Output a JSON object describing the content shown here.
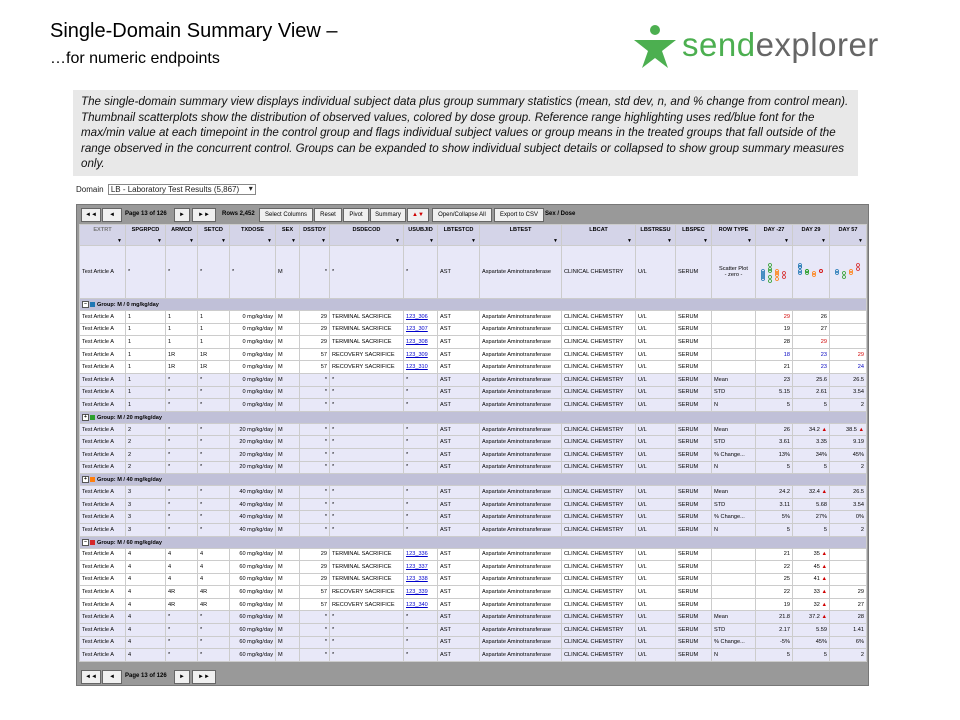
{
  "header": {
    "title": "Single-Domain Summary View –",
    "subtitle": "…for numeric endpoints",
    "logo_text_a": "send",
    "logo_text_b": "explorer"
  },
  "description": "The single-domain summary view displays individual subject data plus group summary statistics (mean, std dev, n, and % change from control mean). Thumbnail scatterplots show the distribution of observed values, colored by dose group. Reference range highlighting uses red/blue font for the max/min value at each timepoint in the control group and flags individual subject values or group means in the treated groups that fall outside of the range observed in the concurrent control. Groups can be expanded to show individual subject details or collapsed to show group summary measures only.",
  "domain": {
    "label": "Domain",
    "value": "LB - Laboratory Test Results (5,867)"
  },
  "toolbar": {
    "first": "◄◄",
    "prev": "◄",
    "page": "Page 13 of 126",
    "next": "►",
    "last": "►►",
    "rows": "Rows 2,452",
    "select_columns": "Select Columns",
    "reset": "Reset",
    "pivot": "Pivot",
    "summary": "Summary",
    "sort": "▲▼",
    "open_collapse": "Open/Collapse All",
    "export": "Export to CSV",
    "sex_dose": "Sex / Dose"
  },
  "columns": [
    "EXTRT",
    "SPGRPCD",
    "ARMCD",
    "SETCD",
    "TXDOSE",
    "SEX",
    "DSSTDY",
    "DSDECOD",
    "USUBJID",
    "LBTESTCD",
    "LBTEST",
    "LBCAT",
    "LBSTRESU",
    "LBSPEC",
    "ROW TYPE",
    "DAY -27",
    "DAY 29",
    "DAY 57"
  ],
  "summary_row": {
    "extrt": "Test Article A",
    "star": "*",
    "sex": "M",
    "lbtestcd": "AST",
    "lbtest": "Aspartate Aminotransferase",
    "lbcat": "CLINICAL CHEMISTRY",
    "unit": "U/L",
    "spec": "SERUM",
    "rowtype": "Scatter Plot",
    "rowtype2": "- zero -"
  },
  "groups": [
    {
      "label": "Group: M / 0 mg/kg/day",
      "color": "#1f77b4",
      "toggle": "–",
      "rows": [
        [
          "Test Article A",
          "1",
          "1",
          "1",
          "0 mg/kg/day",
          "M",
          "29",
          "TERMINAL SACRIFICE",
          "123_306",
          "AST",
          "Aspartate Aminotransferase",
          "CLINICAL CHEMISTRY",
          "U/L",
          "SERUM",
          "",
          "29",
          "26",
          ""
        ],
        [
          "Test Article A",
          "1",
          "1",
          "1",
          "0 mg/kg/day",
          "M",
          "29",
          "TERMINAL SACRIFICE",
          "123_307",
          "AST",
          "Aspartate Aminotransferase",
          "CLINICAL CHEMISTRY",
          "U/L",
          "SERUM",
          "",
          "19",
          "27",
          ""
        ],
        [
          "Test Article A",
          "1",
          "1",
          "1",
          "0 mg/kg/day",
          "M",
          "29",
          "TERMINAL SACRIFICE",
          "123_308",
          "AST",
          "Aspartate Aminotransferase",
          "CLINICAL CHEMISTRY",
          "U/L",
          "SERUM",
          "",
          "28",
          "29",
          ""
        ],
        [
          "Test Article A",
          "1",
          "1R",
          "1R",
          "0 mg/kg/day",
          "M",
          "57",
          "RECOVERY SACRIFICE",
          "123_309",
          "AST",
          "Aspartate Aminotransferase",
          "CLINICAL CHEMISTRY",
          "U/L",
          "SERUM",
          "",
          "18",
          "23",
          "29"
        ],
        [
          "Test Article A",
          "1",
          "1R",
          "1R",
          "0 mg/kg/day",
          "M",
          "57",
          "RECOVERY SACRIFICE",
          "123_310",
          "AST",
          "Aspartate Aminotransferase",
          "CLINICAL CHEMISTRY",
          "U/L",
          "SERUM",
          "",
          "21",
          "23",
          "24"
        ]
      ],
      "stats": [
        [
          "Mean",
          "23",
          "25.6",
          "26.5"
        ],
        [
          "STD",
          "5.15",
          "2.61",
          "3.54"
        ],
        [
          "N",
          "5",
          "5",
          "2"
        ]
      ]
    },
    {
      "label": "Group: M / 20 mg/kg/day",
      "color": "#2ca02c",
      "toggle": "+",
      "dose": "20 mg/kg/day",
      "sp": "2",
      "stats": [
        [
          "Mean",
          "26",
          "34.2 ▲",
          "38.5 ▲"
        ],
        [
          "STD",
          "3.61",
          "3.35",
          "9.19"
        ],
        [
          "% Change...",
          "13%",
          "34%",
          "45%"
        ],
        [
          "N",
          "5",
          "5",
          "2"
        ]
      ]
    },
    {
      "label": "Group: M / 40 mg/kg/day",
      "color": "#ff7f0e",
      "toggle": "+",
      "dose": "40 mg/kg/day",
      "sp": "3",
      "stats": [
        [
          "Mean",
          "24.2",
          "32.4 ▲",
          "26.5"
        ],
        [
          "STD",
          "3.11",
          "5.68",
          "3.54"
        ],
        [
          "% Change...",
          "5%",
          "27%",
          "0%"
        ],
        [
          "N",
          "5",
          "5",
          "2"
        ]
      ]
    },
    {
      "label": "Group: M / 60 mg/kg/day",
      "color": "#d62728",
      "toggle": "–",
      "rows": [
        [
          "Test Article A",
          "4",
          "4",
          "4",
          "60 mg/kg/day",
          "M",
          "29",
          "TERMINAL SACRIFICE",
          "123_336",
          "AST",
          "Aspartate Aminotransferase",
          "CLINICAL CHEMISTRY",
          "U/L",
          "SERUM",
          "",
          "21",
          "35 ▲",
          ""
        ],
        [
          "Test Article A",
          "4",
          "4",
          "4",
          "60 mg/kg/day",
          "M",
          "29",
          "TERMINAL SACRIFICE",
          "123_337",
          "AST",
          "Aspartate Aminotransferase",
          "CLINICAL CHEMISTRY",
          "U/L",
          "SERUM",
          "",
          "22",
          "45 ▲",
          ""
        ],
        [
          "Test Article A",
          "4",
          "4",
          "4",
          "60 mg/kg/day",
          "M",
          "29",
          "TERMINAL SACRIFICE",
          "123_338",
          "AST",
          "Aspartate Aminotransferase",
          "CLINICAL CHEMISTRY",
          "U/L",
          "SERUM",
          "",
          "25",
          "41 ▲",
          ""
        ],
        [
          "Test Article A",
          "4",
          "4R",
          "4R",
          "60 mg/kg/day",
          "M",
          "57",
          "RECOVERY SACRIFICE",
          "123_339",
          "AST",
          "Aspartate Aminotransferase",
          "CLINICAL CHEMISTRY",
          "U/L",
          "SERUM",
          "",
          "22",
          "33 ▲",
          "29"
        ],
        [
          "Test Article A",
          "4",
          "4R",
          "4R",
          "60 mg/kg/day",
          "M",
          "57",
          "RECOVERY SACRIFICE",
          "123_340",
          "AST",
          "Aspartate Aminotransferase",
          "CLINICAL CHEMISTRY",
          "U/L",
          "SERUM",
          "",
          "19",
          "32 ▲",
          "27"
        ]
      ],
      "stats": [
        [
          "Mean",
          "21.8",
          "37.2 ▲",
          "28"
        ],
        [
          "STD",
          "2.17",
          "5.59",
          "1.41"
        ],
        [
          "% Change...",
          "-5%",
          "45%",
          "6%"
        ],
        [
          "N",
          "5",
          "5",
          "2"
        ]
      ]
    }
  ],
  "colors": {
    "red": "#d00000",
    "blue": "#0000c0",
    "header_bg": "#d4d4e8"
  }
}
